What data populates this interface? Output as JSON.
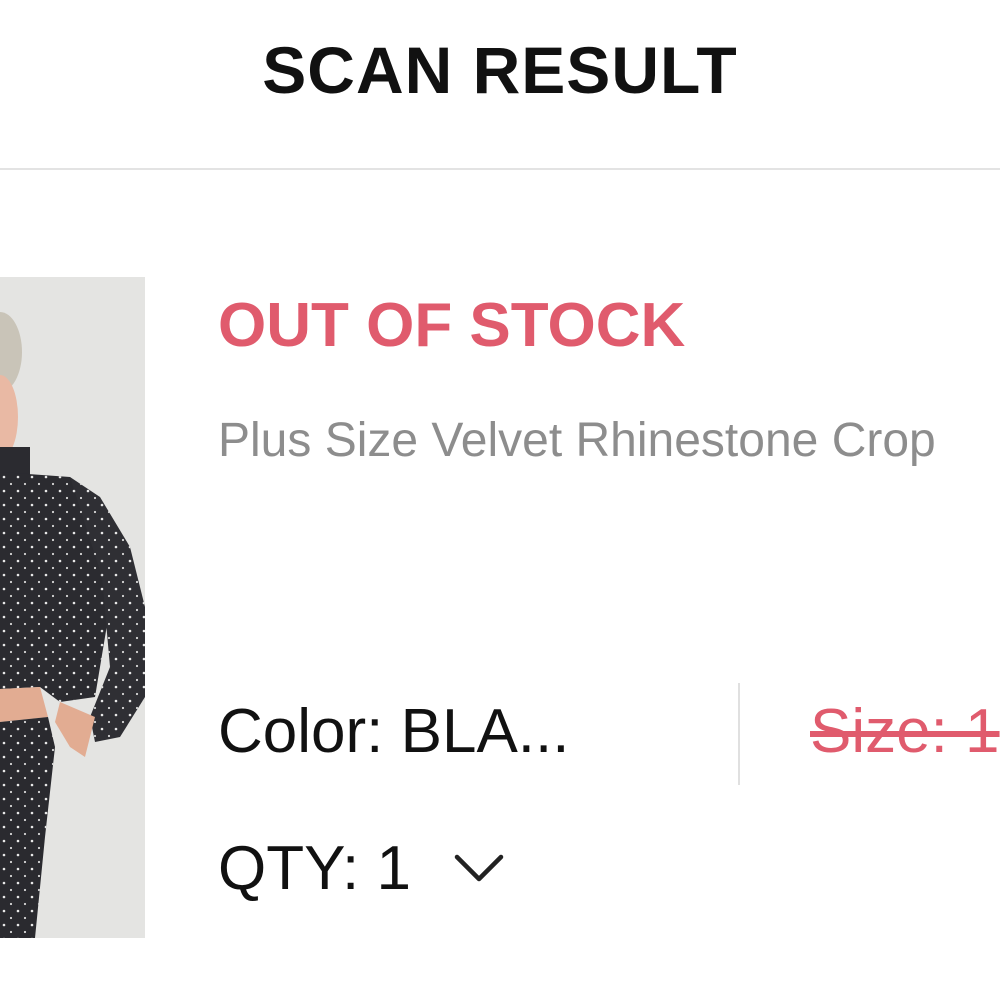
{
  "colors": {
    "accent": "#e05b6d",
    "text": "#111111",
    "muted": "#8d8d8d"
  },
  "header": {
    "title": "SCAN RESULT"
  },
  "product": {
    "image_icon": "product-photo",
    "stock_status": "OUT OF STOCK",
    "name": "Plus Size Velvet Rhinestone Crop",
    "color_label": "Color: BLA...",
    "size_label": "Size: 1",
    "qty_label": "QTY: 1",
    "qty_icon": "chevron-down-icon"
  }
}
